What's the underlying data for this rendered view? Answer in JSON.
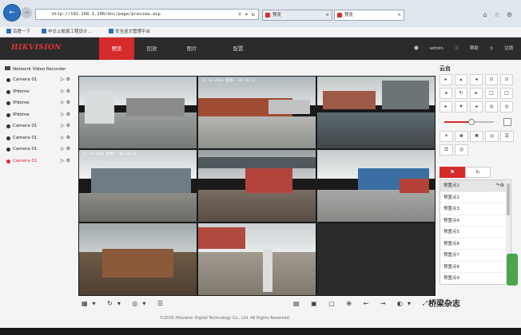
{
  "browser": {
    "address": "http://192.168.1.200/doc/page/preview.asp",
    "address_controls": "⌕ ▾ ↻",
    "tabs": [
      {
        "label": "预览"
      },
      {
        "label": "预览"
      }
    ],
    "window_controls": "⌂ ☆ ⚙",
    "favorites": [
      {
        "label": "百度一下"
      },
      {
        "label": "中交上航局工程设计..."
      },
      {
        "label": "安全巡文管理平台"
      }
    ]
  },
  "header": {
    "logo": "HIKVISION",
    "nav": [
      {
        "label": "预览"
      },
      {
        "label": "回放"
      },
      {
        "label": "图片"
      },
      {
        "label": "配置"
      }
    ],
    "user": "admin",
    "help": "帮助",
    "logout": "注销"
  },
  "sidebar": {
    "device": "Network Video Recorder",
    "cameras": [
      {
        "label": "Camera 01"
      },
      {
        "label": "IPdome"
      },
      {
        "label": "IPdome"
      },
      {
        "label": "IPdome"
      },
      {
        "label": "Camera 01"
      },
      {
        "label": "Camera 01"
      },
      {
        "label": "Camera 01"
      },
      {
        "label": "Camera 01"
      }
    ]
  },
  "video": {
    "osd": [
      "",
      "11-14-2016  星期一  16:26:53",
      "",
      "11-14-2016  星期一  16:26:53",
      "",
      "",
      "",
      "",
      ""
    ]
  },
  "toolbar": {
    "left_icons": "▦▾ ↻▾ ◎▾ ☰",
    "right_icons": "▤ ▣ ▢ ⊕ ← → ◐▾ ⤢"
  },
  "copyright": "©2016 Hikvision Digital Technology Co., Ltd. All Rights Reserved.",
  "ptz": {
    "title": "云台",
    "buttons": [
      "▸",
      "▴",
      "◂",
      "⊙",
      "⊙",
      "◂",
      "↻",
      "▸",
      "□",
      "□",
      "▸",
      "▾",
      "◂",
      "◎",
      "◎"
    ],
    "speed_value": 0.55,
    "row2": [
      "☀",
      "❀",
      "✖",
      "◎",
      "☰"
    ],
    "row3": [
      "☰",
      "◎"
    ],
    "preset_tabs": [
      {
        "label": "⚑"
      },
      {
        "label": "↻"
      }
    ],
    "presets": [
      {
        "label": "预置点1"
      },
      {
        "label": "预置点2"
      },
      {
        "label": "预置点3"
      },
      {
        "label": "预置点4"
      },
      {
        "label": "预置点5"
      },
      {
        "label": "预置点6"
      },
      {
        "label": "预置点7"
      },
      {
        "label": "预置点8"
      },
      {
        "label": "预置点9"
      }
    ]
  },
  "watermark": "桥梁杂志"
}
